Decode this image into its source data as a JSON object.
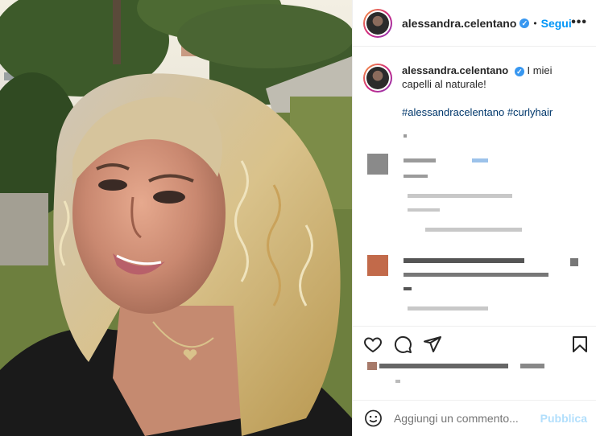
{
  "header": {
    "username": "alessandra.celentano",
    "verified_mark": "✓",
    "separator": "•",
    "follow_label": "Segui",
    "more_label": "•••"
  },
  "caption": {
    "username": "alessandra.celentano",
    "verified_mark": "✓",
    "text": "I miei capelli al naturale!",
    "hashtags": "#alessandracelentano #curlyhair"
  },
  "icons": {
    "like": "heart-icon",
    "comment": "comment-icon",
    "share": "share-icon",
    "save": "bookmark-icon",
    "emoji": "emoji-icon"
  },
  "add_comment": {
    "placeholder": "Aggiungi un commento...",
    "publish_label": "Pubblica"
  },
  "colors": {
    "accent": "#0095f6",
    "link": "#00376b",
    "publish_disabled": "#b2dffc",
    "verified": "#3897f0"
  }
}
